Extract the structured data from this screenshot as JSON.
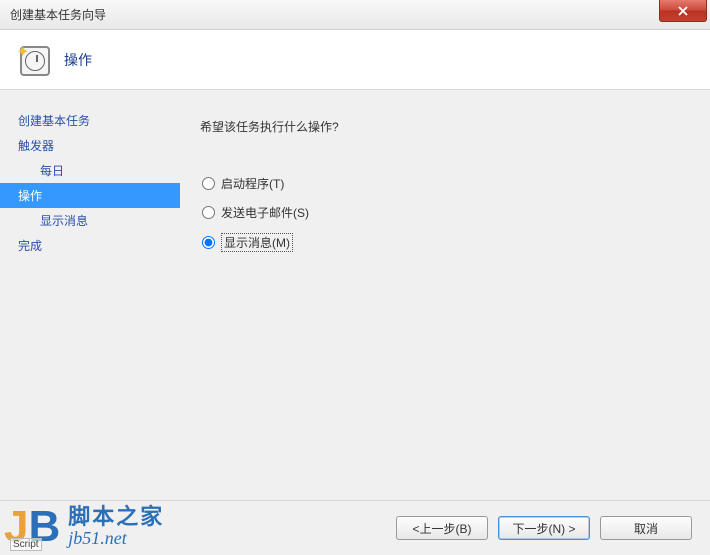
{
  "titlebar": {
    "title": "创建基本任务向导"
  },
  "header": {
    "title": "操作"
  },
  "sidebar": {
    "items": [
      {
        "label": "创建基本任务",
        "type": "item",
        "selected": false
      },
      {
        "label": "触发器",
        "type": "item",
        "selected": false
      },
      {
        "label": "每日",
        "type": "sub",
        "selected": false
      },
      {
        "label": "操作",
        "type": "item",
        "selected": true
      },
      {
        "label": "显示消息",
        "type": "sub",
        "selected": false
      },
      {
        "label": "完成",
        "type": "item",
        "selected": false
      }
    ]
  },
  "content": {
    "prompt": "希望该任务执行什么操作?",
    "options": [
      {
        "label": "启动程序(T)",
        "checked": false
      },
      {
        "label": "发送电子邮件(S)",
        "checked": false
      },
      {
        "label": "显示消息(M)",
        "checked": true
      }
    ]
  },
  "footer": {
    "back": "<上一步(B)",
    "next": "下一步(N) >",
    "cancel": "取消"
  },
  "watermark": {
    "cn": "脚本之家",
    "url": "jb51.net",
    "script_label": "Script"
  }
}
